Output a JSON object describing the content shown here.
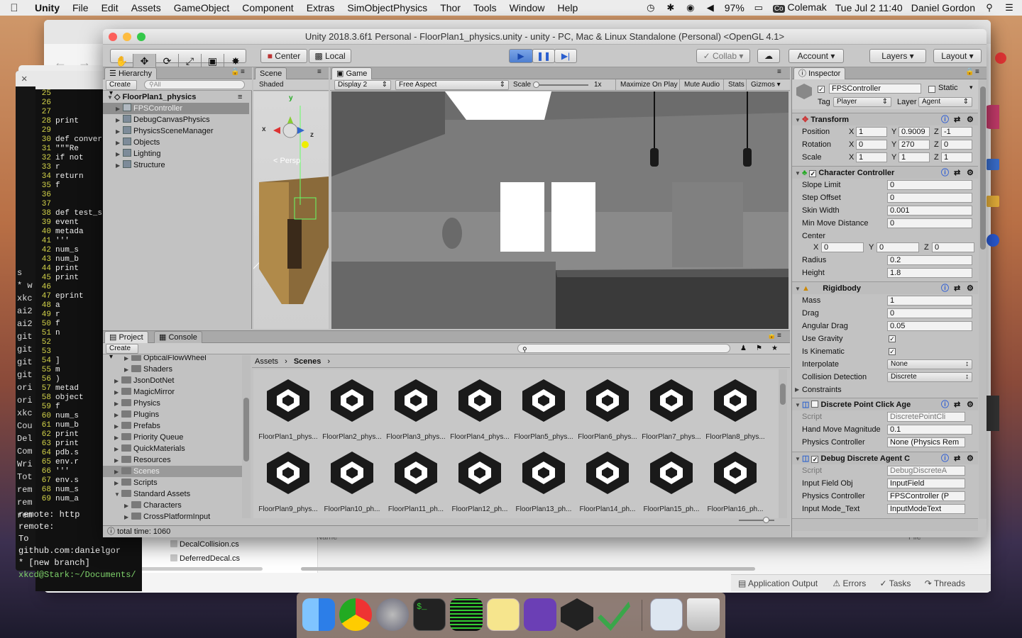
{
  "menubar": {
    "app": "Unity",
    "items": [
      "File",
      "Edit",
      "Assets",
      "GameObject",
      "Component",
      "Extras",
      "SimObjectPhysics",
      "Thor",
      "Tools",
      "Window",
      "Help"
    ],
    "battery": "97%",
    "keyboard": "Colemak",
    "clock": "Tue Jul 2  11:40",
    "user": "Daniel Gordon"
  },
  "code": {
    "lines": [
      {
        "n": "25",
        "t": ""
      },
      {
        "n": "26",
        "t": ""
      },
      {
        "n": "27",
        "t": ""
      },
      {
        "n": "28",
        "t": "    print"
      },
      {
        "n": "29",
        "t": ""
      },
      {
        "n": "30",
        "t": "def conver"
      },
      {
        "n": "31",
        "t": "    \"\"\"Re"
      },
      {
        "n": "32",
        "t": "    if not"
      },
      {
        "n": "33",
        "t": "        r"
      },
      {
        "n": "34",
        "t": "    return"
      },
      {
        "n": "35",
        "t": "        f"
      },
      {
        "n": "36",
        "t": ""
      },
      {
        "n": "37",
        "t": ""
      },
      {
        "n": "38",
        "t": "def test_s"
      },
      {
        "n": "39",
        "t": "    event"
      },
      {
        "n": "40",
        "t": "    metada"
      },
      {
        "n": "41",
        "t": "    '''"
      },
      {
        "n": "42",
        "t": "    num_s"
      },
      {
        "n": "43",
        "t": "    num_b"
      },
      {
        "n": "44",
        "t": "    print"
      },
      {
        "n": "45",
        "t": "    print"
      },
      {
        "n": "46",
        "t": ""
      },
      {
        "n": "47",
        "t": "    eprint"
      },
      {
        "n": "48",
        "t": "        a"
      },
      {
        "n": "49",
        "t": "        r"
      },
      {
        "n": "50",
        "t": "        f"
      },
      {
        "n": "51",
        "t": "        n"
      },
      {
        "n": "52",
        "t": ""
      },
      {
        "n": "53",
        "t": ""
      },
      {
        "n": "54",
        "t": "        ]"
      },
      {
        "n": "55",
        "t": "        m"
      },
      {
        "n": "56",
        "t": "        )"
      },
      {
        "n": "57",
        "t": "    metad"
      },
      {
        "n": "58",
        "t": "    object"
      },
      {
        "n": "59",
        "t": "        f"
      },
      {
        "n": "60",
        "t": "    num_s"
      },
      {
        "n": "61",
        "t": "    num_b"
      },
      {
        "n": "62",
        "t": "    print"
      },
      {
        "n": "63",
        "t": "    print"
      },
      {
        "n": "64",
        "t": "    pdb.s"
      },
      {
        "n": "65",
        "t": "    env.r"
      },
      {
        "n": "66",
        "t": "    '''"
      },
      {
        "n": "67",
        "t": "    env.s"
      },
      {
        "n": "68",
        "t": "    num_s"
      },
      {
        "n": "69",
        "t": "    num_a"
      }
    ]
  },
  "terminal": {
    "left_lines": [
      "s",
      "* w",
      "xkc",
      "ai2",
      "ai2",
      "git",
      "git",
      "git",
      "git",
      "ori",
      "ori",
      "xkc",
      "Cou",
      "Del",
      "Com",
      "Wri",
      "Tot",
      "rem",
      "rem",
      "rem"
    ],
    "bottom_lines": [
      "remote:     http",
      "remote:",
      "To github.com:danielgor",
      "  * [new branch]",
      "xkcd@Stark:~/Documents/"
    ]
  },
  "bgwin": {
    "files": [
      "DecalCollision.cs",
      "DeferredDecal.cs"
    ],
    "name_header": "Name",
    "file_header": "File",
    "bottom": [
      "Application Output",
      "Errors",
      "Tasks",
      "Threads"
    ]
  },
  "unity": {
    "title": "Unity 2018.3.6f1 Personal - FloorPlan1_physics.unity - unity - PC, Mac & Linux Standalone (Personal) <OpenGL 4.1>",
    "toolbar": {
      "center": "Center",
      "local": "Local",
      "collab": "Collab",
      "account": "Account",
      "layers": "Layers",
      "layout": "Layout"
    },
    "hierarchy": {
      "tab": "Hierarchy",
      "create": "Create",
      "search": "All",
      "scene": "FloorPlan1_physics",
      "items": [
        "FPSController",
        "DebugCanvasPhysics",
        "PhysicsSceneManager",
        "Objects",
        "Lighting",
        "Structure"
      ]
    },
    "scene": {
      "tab": "Scene",
      "mode": "Shaded",
      "persp": "Persp"
    },
    "game": {
      "tab": "Game",
      "display": "Display 2",
      "aspect": "Free Aspect",
      "scale": "Scale",
      "scale_val": "1x",
      "buttons": [
        "Maximize On Play",
        "Mute Audio",
        "Stats",
        "Gizmos"
      ]
    },
    "project": {
      "tab": "Project",
      "console": "Console",
      "create": "Create",
      "breadcrumb": [
        "Assets",
        "Scenes"
      ],
      "tree": [
        {
          "t": "OpticalFlowWheel",
          "i": 2
        },
        {
          "t": "Shaders",
          "i": 2
        },
        {
          "t": "JsonDotNet",
          "i": 1
        },
        {
          "t": "MagicMirror",
          "i": 1
        },
        {
          "t": "Physics",
          "i": 1
        },
        {
          "t": "Plugins",
          "i": 1
        },
        {
          "t": "Prefabs",
          "i": 1
        },
        {
          "t": "Priority Queue",
          "i": 1
        },
        {
          "t": "QuickMaterials",
          "i": 1
        },
        {
          "t": "Resources",
          "i": 1
        },
        {
          "t": "Scenes",
          "i": 1
        },
        {
          "t": "Scripts",
          "i": 1
        },
        {
          "t": "Standard Assets",
          "i": 1
        },
        {
          "t": "Characters",
          "i": 2
        },
        {
          "t": "CrossPlatformInput",
          "i": 2
        }
      ],
      "assets": [
        "FloorPlan1_phys...",
        "FloorPlan2_phys...",
        "FloorPlan3_phys...",
        "FloorPlan4_phys...",
        "FloorPlan5_phys...",
        "FloorPlan6_phys...",
        "FloorPlan7_phys...",
        "FloorPlan8_phys...",
        "FloorPlan9_phys...",
        "FloorPlan10_ph...",
        "FloorPlan11_ph...",
        "FloorPlan12_ph...",
        "FloorPlan13_ph...",
        "FloorPlan14_ph...",
        "FloorPlan15_ph...",
        "FloorPlan16_ph..."
      ]
    },
    "status": "total time: 1060",
    "inspector": {
      "tab": "Inspector",
      "object": "FPSController",
      "static": "Static",
      "tag_label": "Tag",
      "tag": "Player",
      "layer_label": "Layer",
      "layer": "Agent",
      "transform": {
        "title": "Transform",
        "position": [
          "1",
          "0.9009",
          "-1"
        ],
        "rotation": [
          "0",
          "270",
          "0"
        ],
        "scale": [
          "1",
          "1",
          "1"
        ]
      },
      "cc": {
        "title": "Character Controller",
        "slope": "0",
        "step": "0",
        "skin": "0.001",
        "minmove": "0",
        "center": [
          "0",
          "0",
          "0"
        ],
        "radius": "0.2",
        "height": "1.8"
      },
      "rb": {
        "title": "Rigidbody",
        "mass": "1",
        "drag": "0",
        "adrag": "0.05",
        "interp": "None",
        "coll": "Discrete",
        "constraints": "Constraints"
      },
      "dpc": {
        "title": "Discrete Point Click Age",
        "script": "DiscretePointCli",
        "hmm": "0.1",
        "pc": "None (Physics Rem"
      },
      "dda": {
        "title": "Debug Discrete Agent C",
        "script": "DebugDiscreteA",
        "ifo": "InputField",
        "pc": "FPSController (P",
        "imt": "InputModeText"
      },
      "labels": {
        "position": "Position",
        "rotation": "Rotation",
        "scale": "Scale",
        "slope": "Slope Limit",
        "step": "Step Offset",
        "skin": "Skin Width",
        "minmove": "Min Move Distance",
        "center": "Center",
        "radius": "Radius",
        "height": "Height",
        "mass": "Mass",
        "drag": "Drag",
        "adrag": "Angular Drag",
        "grav": "Use Gravity",
        "kin": "Is Kinematic",
        "interp": "Interpolate",
        "coll": "Collision Detection",
        "script": "Script",
        "hmm": "Hand Move Magnitude",
        "pc": "Physics Controller",
        "ifo": "Input Field Obj",
        "imt": "Input Mode_Text"
      }
    }
  }
}
